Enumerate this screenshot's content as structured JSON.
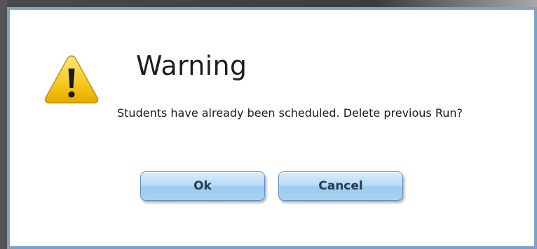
{
  "dialog": {
    "title": "Warning",
    "icon": "warning-icon",
    "message": "Students have already been scheduled. Delete previous Run?",
    "ok_label": "Ok",
    "cancel_label": "Cancel"
  },
  "colors": {
    "dialog_border": "#7fa0c8",
    "button_fill": "#b9dcf6",
    "icon_yellow": "#f6c81e"
  }
}
